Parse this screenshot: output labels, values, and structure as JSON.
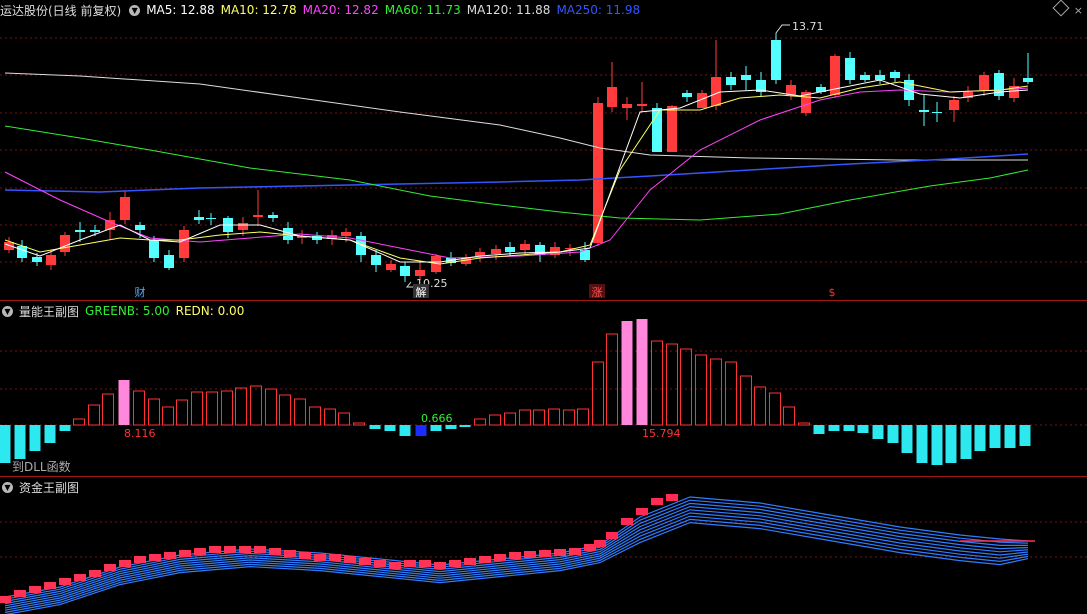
{
  "main": {
    "stock_title": "运达股份(日线 前复权)",
    "ma": [
      {
        "label": "MA5: 12.88",
        "color": "#ffffff"
      },
      {
        "label": "MA10: 12.78",
        "color": "#ffff66"
      },
      {
        "label": "MA20: 12.82",
        "color": "#ff44ff"
      },
      {
        "label": "MA60: 11.73",
        "color": "#33ee33"
      },
      {
        "label": "MA120: 11.88",
        "color": "#dddddd"
      },
      {
        "label": "MA250: 11.98",
        "color": "#3355ff"
      }
    ],
    "high_label": "13.71",
    "low_label": "10.25",
    "events": [
      {
        "text": "财",
        "color": "#55aaff"
      },
      {
        "text": "解",
        "color": "#ffffff"
      },
      {
        "text": "涨",
        "color": "#ff5555"
      },
      {
        "text": "$",
        "color": "#ff3333"
      }
    ],
    "colors": {
      "up": "#ff3b3b",
      "down": "#54ffff"
    }
  },
  "sub1": {
    "title": "量能王副图",
    "greenb": "GREENB: 5.00",
    "redn": "REDN: 0.00",
    "labels": [
      "8.116",
      "0.666",
      "15.794"
    ],
    "hint": "到DLL函数"
  },
  "sub2": {
    "title": "资金王副图"
  }
}
